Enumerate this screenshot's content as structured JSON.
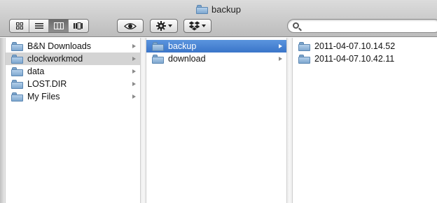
{
  "window": {
    "title": "backup",
    "title_icon": "folder-icon"
  },
  "toolbar": {
    "view_modes": [
      {
        "name": "icon-view",
        "icon": "grid-icon",
        "active": false
      },
      {
        "name": "list-view",
        "icon": "list-icon",
        "active": false
      },
      {
        "name": "column-view",
        "icon": "columns-icon",
        "active": true
      },
      {
        "name": "coverflow-view",
        "icon": "coverflow-icon",
        "active": false
      }
    ],
    "quicklook_icon": "eye-icon",
    "action_icon": "gear-icon",
    "dropbox_icon": "dropbox-icon",
    "search": {
      "value": "",
      "placeholder": ""
    }
  },
  "columns": [
    {
      "items": [
        {
          "label": "B&N Downloads",
          "has_children": true,
          "state": "normal"
        },
        {
          "label": "clockworkmod",
          "has_children": true,
          "state": "selected-inactive"
        },
        {
          "label": "data",
          "has_children": true,
          "state": "normal"
        },
        {
          "label": "LOST.DIR",
          "has_children": true,
          "state": "normal"
        },
        {
          "label": "My Files",
          "has_children": true,
          "state": "normal"
        }
      ]
    },
    {
      "items": [
        {
          "label": "backup",
          "has_children": true,
          "state": "selected-active"
        },
        {
          "label": "download",
          "has_children": true,
          "state": "normal"
        }
      ]
    },
    {
      "items": [
        {
          "label": "2011-04-07.10.14.52",
          "has_children": false,
          "state": "normal"
        },
        {
          "label": "2011-04-07.10.42.11",
          "has_children": false,
          "state": "normal"
        }
      ]
    }
  ],
  "colors": {
    "selection_active": "#3a75c9",
    "selection_inactive": "#d4d4d4",
    "folder": "#7ea8cf"
  }
}
